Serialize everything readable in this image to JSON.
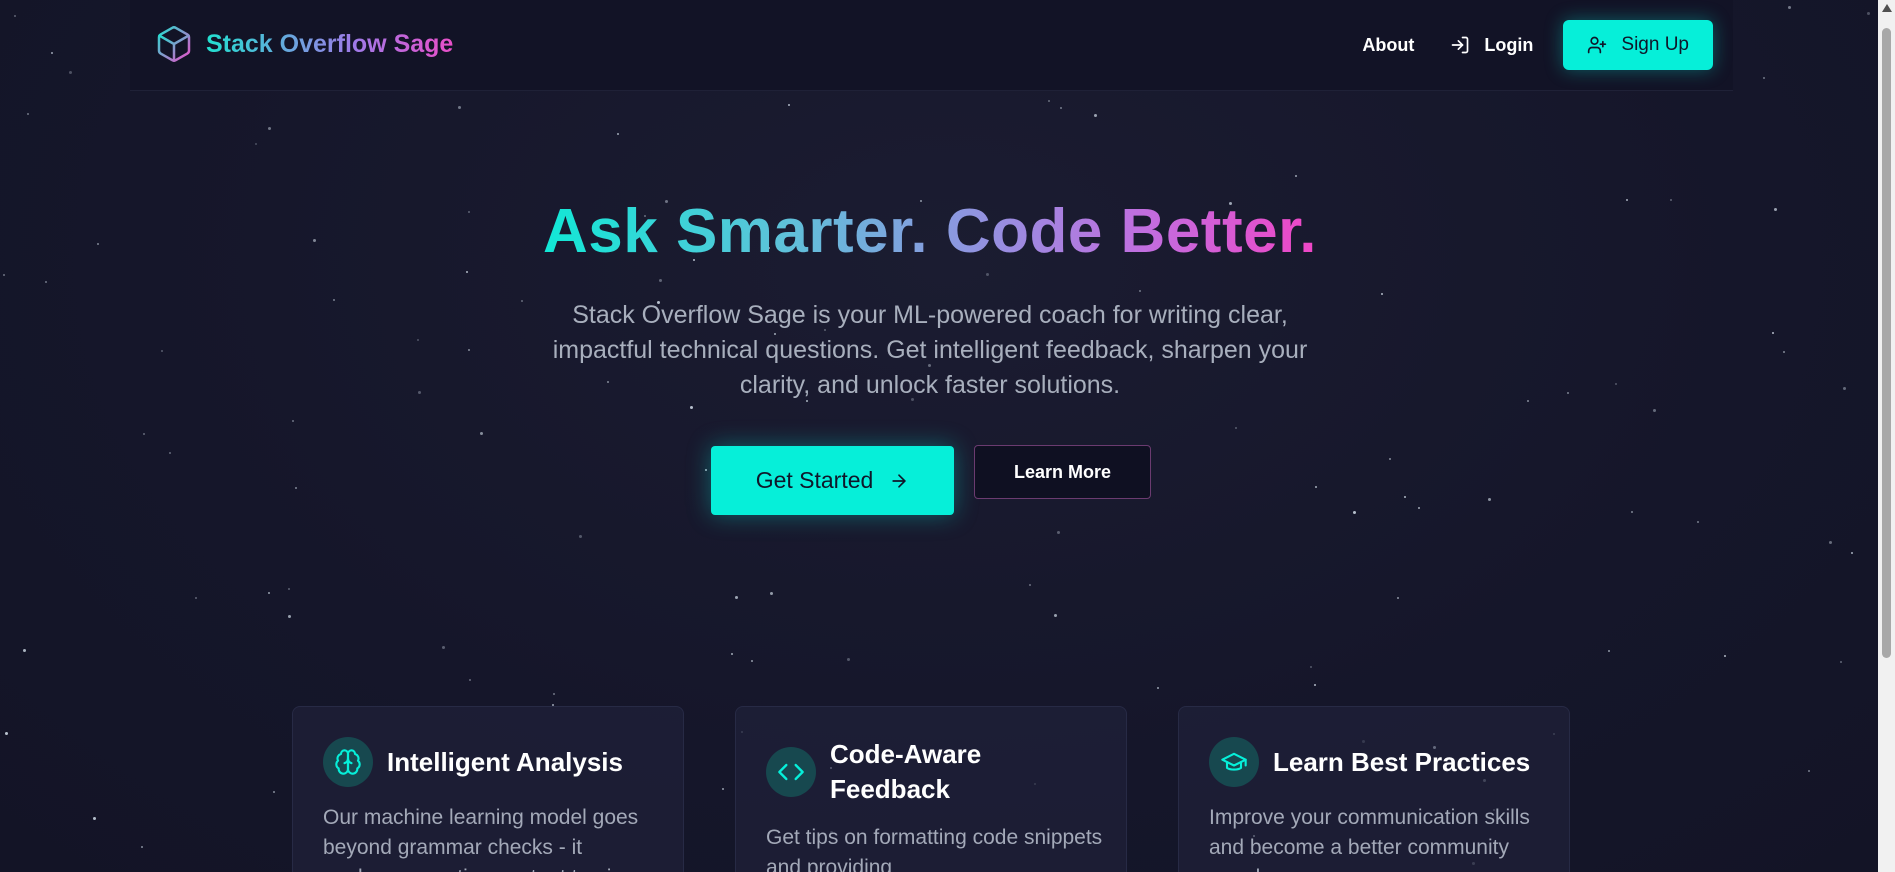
{
  "colors": {
    "accent": "#06efd9",
    "background": "#161729",
    "gradient_start": "#11e8d6",
    "gradient_end": "#ef46c6"
  },
  "header": {
    "brand_icon": "cube-icon",
    "brand_name": "Stack Overflow Sage",
    "nav": {
      "about_label": "About",
      "login_label": "Login",
      "login_icon": "login-icon",
      "signup_label": "Sign Up",
      "signup_icon": "user-plus-icon"
    }
  },
  "hero": {
    "title": "Ask Smarter. Code Better.",
    "subtitle": "Stack Overflow Sage is your ML-powered coach for writing clear, impactful technical questions. Get intelligent feedback, sharpen your clarity, and unlock faster solutions.",
    "primary_button": "Get Started",
    "primary_button_icon": "arrow-right-icon",
    "secondary_button": "Learn More"
  },
  "features": [
    {
      "icon": "brain-icon",
      "title": "Intelligent Analysis",
      "text": "Our machine learning model goes beyond grammar checks - it analyzes question content to give"
    },
    {
      "icon": "code-icon",
      "title": "Code-Aware Feedback",
      "text": "Get tips on formatting code snippets and providing"
    },
    {
      "icon": "graduation-cap-icon",
      "title": "Learn Best Practices",
      "text": "Improve your communication skills and become a better community member."
    }
  ]
}
